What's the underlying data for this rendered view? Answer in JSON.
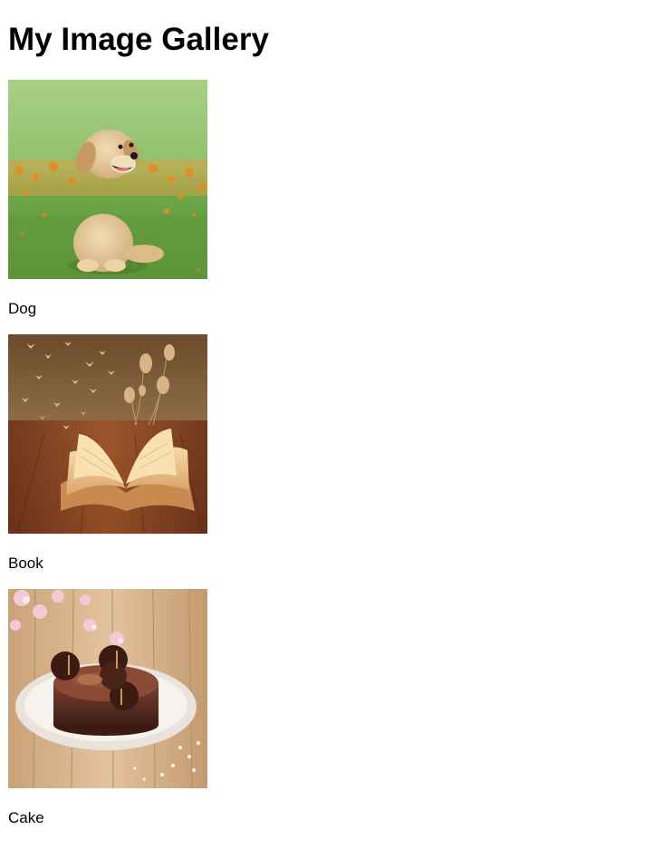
{
  "page": {
    "title": "My Image Gallery"
  },
  "gallery": {
    "items": [
      {
        "caption": "Dog"
      },
      {
        "caption": "Book"
      },
      {
        "caption": "Cake"
      }
    ]
  }
}
